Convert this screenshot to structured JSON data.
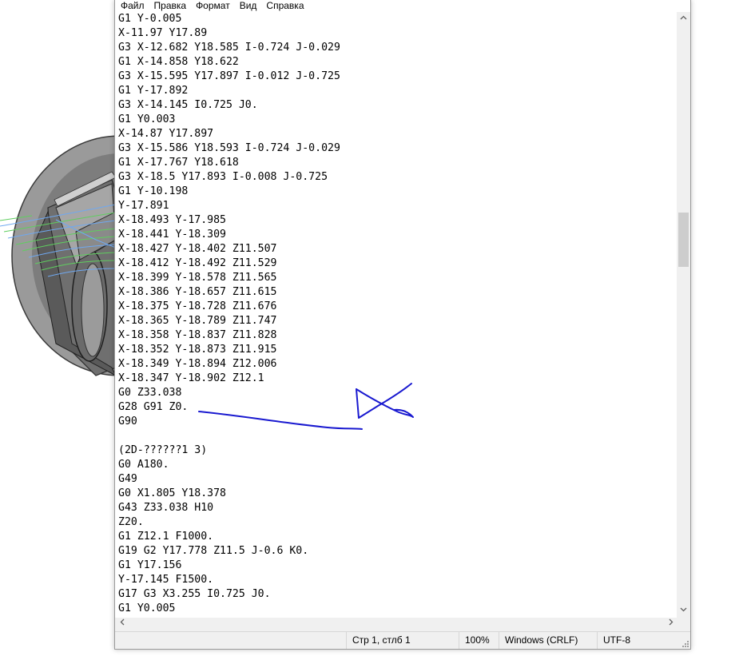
{
  "menu": {
    "items": [
      "Файл",
      "Правка",
      "Формат",
      "Вид",
      "Справка"
    ]
  },
  "editor": {
    "lines": [
      "G1 Y-0.005",
      "X-11.97 Y17.89",
      "G3 X-12.682 Y18.585 I-0.724 J-0.029",
      "G1 X-14.858 Y18.622",
      "G3 X-15.595 Y17.897 I-0.012 J-0.725",
      "G1 Y-17.892",
      "G3 X-14.145 I0.725 J0.",
      "G1 Y0.003",
      "X-14.87 Y17.897",
      "G3 X-15.586 Y18.593 I-0.724 J-0.029",
      "G1 X-17.767 Y18.618",
      "G3 X-18.5 Y17.893 I-0.008 J-0.725",
      "G1 Y-10.198",
      "Y-17.891",
      "X-18.493 Y-17.985",
      "X-18.441 Y-18.309",
      "X-18.427 Y-18.402 Z11.507",
      "X-18.412 Y-18.492 Z11.529",
      "X-18.399 Y-18.578 Z11.565",
      "X-18.386 Y-18.657 Z11.615",
      "X-18.375 Y-18.728 Z11.676",
      "X-18.365 Y-18.789 Z11.747",
      "X-18.358 Y-18.837 Z11.828",
      "X-18.352 Y-18.873 Z11.915",
      "X-18.349 Y-18.894 Z12.006",
      "X-18.347 Y-18.902 Z12.1",
      "G0 Z33.038",
      "G28 G91 Z0.",
      "G90",
      "",
      "(2D-??????1 3)",
      "G0 A180.",
      "G49",
      "G0 X1.805 Y18.378",
      "G43 Z33.038 H10",
      "Z20.",
      "G1 Z12.1 F1000.",
      "G19 G2 Y17.778 Z11.5 J-0.6 K0.",
      "G1 Y17.156",
      "Y-17.145 F1500.",
      "G17 G3 X3.255 I0.725 J0.",
      "G1 Y0.005"
    ]
  },
  "statusbar": {
    "position": "Стр 1, стлб 1",
    "zoom": "100%",
    "line_endings": "Windows (CRLF)",
    "encoding": "UTF-8"
  },
  "colors": {
    "ink": "#1a1ad0",
    "toolpath_green": "#5fce5f",
    "toolpath_blue": "#6fa8f0",
    "model_gray": "#8c8c8c"
  },
  "icons": {
    "scroll_up": "chevron-up-icon",
    "scroll_down": "chevron-down-icon",
    "scroll_left": "chevron-left-icon",
    "scroll_right": "chevron-right-icon",
    "resize_grip": "resize-grip-icon"
  }
}
